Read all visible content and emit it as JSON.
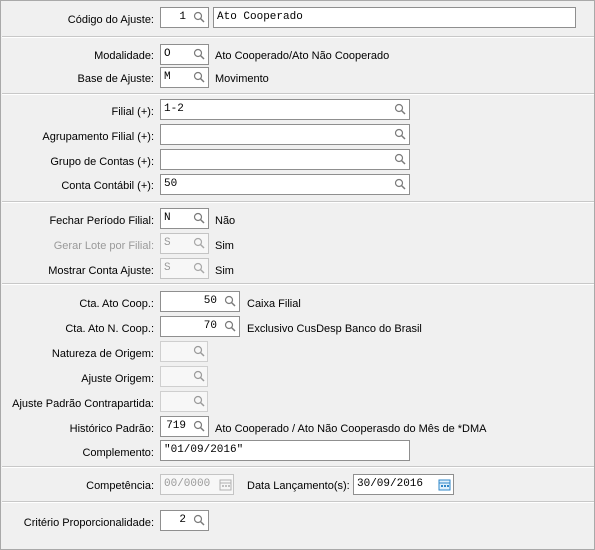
{
  "codigo": {
    "label": "Código do Ajuste:",
    "value": "1",
    "description": "Ato Cooperado"
  },
  "modalidade": {
    "label": "Modalidade:",
    "value": "O",
    "description": "Ato Cooperado/Ato Não Cooperado"
  },
  "base_ajuste": {
    "label": "Base de Ajuste:",
    "value": "M",
    "description": "Movimento"
  },
  "filial": {
    "label": "Filial (+):",
    "value": "1-2"
  },
  "agrupamento_filial": {
    "label": "Agrupamento Filial (+):",
    "value": ""
  },
  "grupo_contas": {
    "label": "Grupo de Contas (+):",
    "value": ""
  },
  "conta_contabil": {
    "label": "Conta Contábil (+):",
    "value": "50"
  },
  "fechar_periodo": {
    "label": "Fechar Período Filial:",
    "value": "N",
    "description": "Não"
  },
  "gerar_lote": {
    "label": "Gerar Lote por Filial:",
    "value": "S",
    "description": "Sim"
  },
  "mostrar_conta": {
    "label": "Mostrar Conta Ajuste:",
    "value": "S",
    "description": "Sim"
  },
  "cta_ato_coop": {
    "label": "Cta. Ato Coop.:",
    "value": "50",
    "description": "Caixa Filial"
  },
  "cta_ato_n_coop": {
    "label": "Cta. Ato N. Coop.:",
    "value": "70",
    "description": "Exclusivo CusDesp Banco do Brasil"
  },
  "natureza_origem": {
    "label": "Natureza de Origem:"
  },
  "ajuste_origem": {
    "label": "Ajuste Origem:"
  },
  "ajuste_padrao": {
    "label": "Ajuste Padrão Contrapartida:"
  },
  "historico_padrao": {
    "label": "Histórico Padrão:",
    "value": "719",
    "description": "Ato Cooperado / Ato Não Cooperasdo do Mês de *DMA"
  },
  "complemento": {
    "label": "Complemento:",
    "value": "\"01/09/2016\""
  },
  "competencia": {
    "label": "Competência:",
    "value": "00/0000"
  },
  "data_lancamento": {
    "label": "Data Lançamento(s):",
    "value": "30/09/2016"
  },
  "criterio": {
    "label": "Critério Proporcionalidade:",
    "value": "2"
  },
  "icons": {
    "lookup": "magnifier-icon",
    "calendar": "calendar-icon"
  }
}
